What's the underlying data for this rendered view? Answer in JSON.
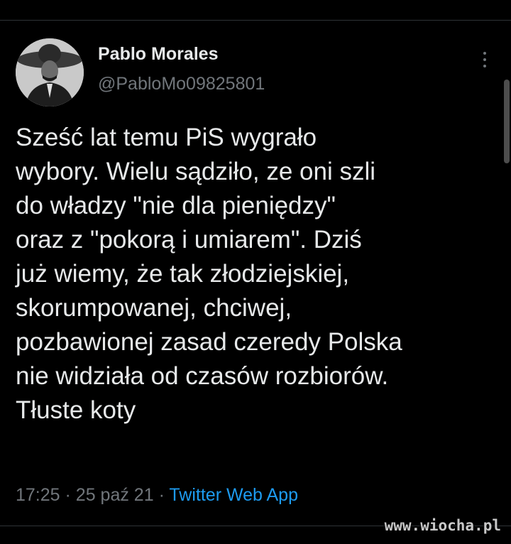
{
  "tweet": {
    "author": {
      "display_name": "Pablo Morales",
      "handle": "@PabloMo09825801",
      "avatar_icon": "profile-photo"
    },
    "text": "Sześć lat temu PiS wygrało\nwybory. Wielu sądziło, ze oni szli\ndo władzy \"nie dla pieniędzy\"\noraz z \"pokorą i umiarem\". Dziś\njuż wiemy, że tak złodziejskiej,\nskorumpowanej, chciwej,\npozbawionej zasad czeredy Polska\nnie widziała od czasów rozbiorów.\nTłuste koty",
    "time": "17:25",
    "separator": "·",
    "date": "25 paź 21",
    "source": "Twitter Web App",
    "menu_icon": "more-vertical-icon"
  },
  "watermark": "www.wiocha.pl",
  "colors": {
    "background": "#000000",
    "text_primary": "#e7e9ea",
    "text_secondary": "#71767b",
    "link": "#1d9bf0",
    "divider": "#2f3336"
  }
}
